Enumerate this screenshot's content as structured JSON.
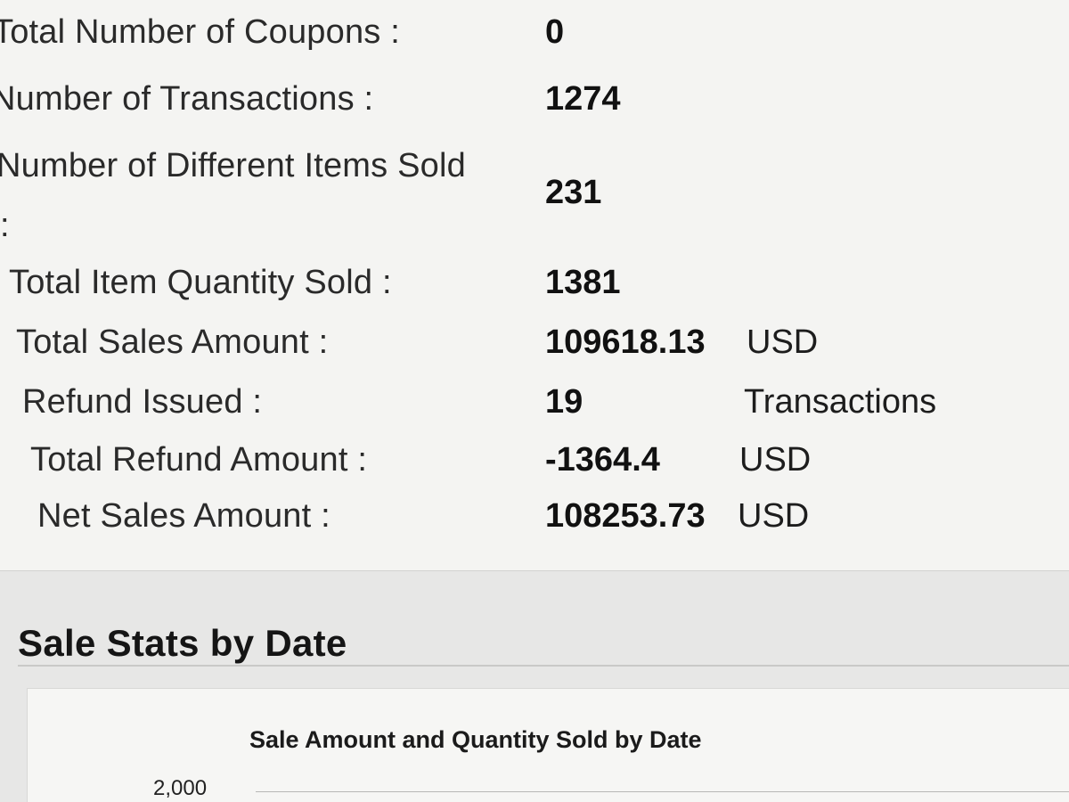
{
  "summary": {
    "total_coupons_label": "Total Number of Coupons :",
    "total_coupons_value": "0",
    "transactions_label": "Number of Transactions :",
    "transactions_value": "1274",
    "different_items_label_line1": "Number of Different Items Sold",
    "different_items_label_line2": ":",
    "different_items_value": "231",
    "item_quantity_label": "Total Item Quantity Sold :",
    "item_quantity_value": "1381",
    "sales_amount_label": "Total Sales Amount :",
    "sales_amount_value": "109618.13",
    "sales_amount_unit": "USD",
    "refund_issued_label": "Refund Issued :",
    "refund_issued_value": "19",
    "refund_issued_unit": "Transactions",
    "refund_amount_label": "Total Refund Amount :",
    "refund_amount_value": "-1364.4",
    "refund_amount_unit": "USD",
    "net_sales_label": "Net Sales Amount :",
    "net_sales_value": "108253.73",
    "net_sales_unit": "USD"
  },
  "sale_stats": {
    "section_title": "Sale Stats by Date",
    "chart_title": "Sale Amount and Quantity Sold by Date",
    "visible_y_tick": "2,000"
  }
}
